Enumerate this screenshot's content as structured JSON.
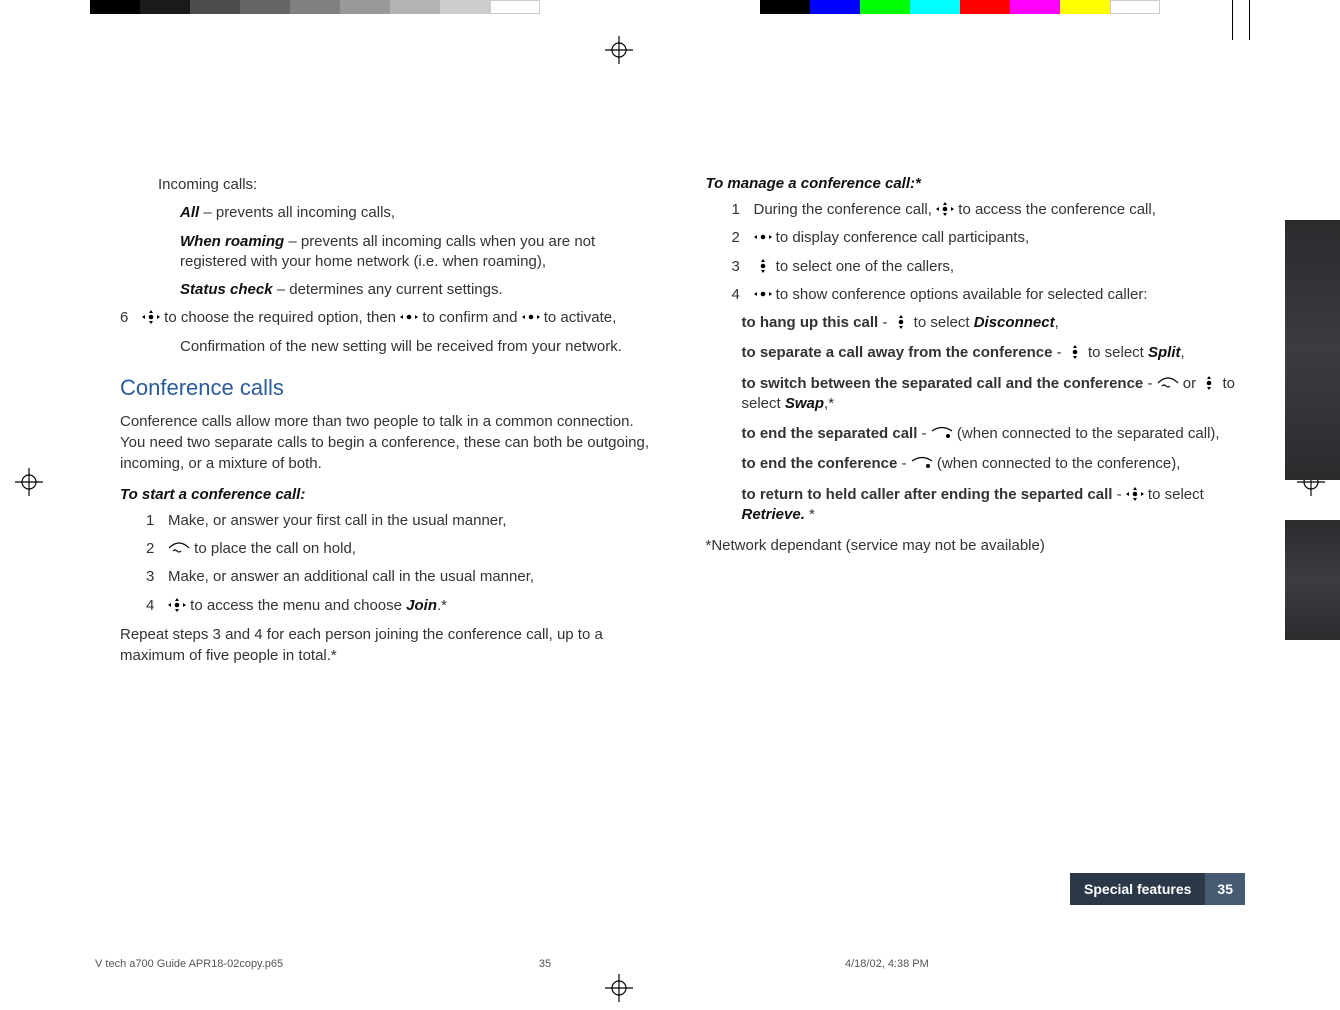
{
  "left": {
    "incoming_header": "Incoming calls:",
    "all_label": "All",
    "all_text": " – prevents all incoming calls,",
    "roam_label": "When roaming",
    "roam_text": " – prevents all incoming calls when you are not registered with your home network (i.e. when roaming),",
    "status_label": "Status check",
    "status_text": " – determines any current settings.",
    "step6_num": "6",
    "step6_a": " to choose the required option, then ",
    "step6_b": " to confirm and ",
    "step6_c": " to activate,",
    "confirm_text": "Confirmation of the new setting will be received from your network.",
    "h2": "Conference calls",
    "intro": "Conference calls allow more than two people to talk in a common connection. You need two separate calls to begin a conference, these can both be outgoing, incoming, or a mixture of both.",
    "start_head": "To start a conference call:",
    "s1_num": "1",
    "s1": "Make, or answer your first call in the usual manner,",
    "s2_num": "2",
    "s2": " to place the call on hold,",
    "s3_num": "3",
    "s3": "Make, or answer an additional call in the usual manner,",
    "s4_num": "4",
    "s4_a": " to access the menu and choose ",
    "s4_join": "Join",
    "s4_b": ".*",
    "repeat": "Repeat steps 3 and 4 for each person joining the conference call, up to a maximum of five people in total.*"
  },
  "right": {
    "manage_head": "To manage a conference call:*",
    "m1_num": "1",
    "m1_a": "During the conference call, ",
    "m1_b": " to access the conference call,",
    "m2_num": "2",
    "m2": "  to display conference call participants,",
    "m3_num": "3",
    "m3": " to select one of the callers,",
    "m4_num": "4",
    "m4": "  to show conference options available for selected caller:",
    "hang_label": "to hang up this call",
    "hang_a": " - ",
    "hang_b": " to select ",
    "hang_disc": " Disconnect",
    "hang_end": ",",
    "sep_label": "to separate a call away from the conference",
    "sep_a": " - ",
    "sep_b": " to select ",
    "sep_split": "Split",
    "sep_end": ",",
    "swap_label": "to switch between the separated call and the conference",
    "swap_a": " - ",
    "swap_b": " or ",
    "swap_c": " to select ",
    "swap_word": "Swap",
    "swap_end": ",*",
    "endsep_label": "to end the separated call",
    "endsep_a": " - ",
    "endsep_b": " (when connected to the separated call),",
    "endconf_label": "to end the conference",
    "endconf_a": " - ",
    "endconf_b": " (when connected to the conference),",
    "retr_label": "to return to held caller after ending the separted call",
    "retr_a": " - ",
    "retr_b": "  to select ",
    "retr_word": "Retrieve.",
    "retr_end": " *",
    "note": "*Network dependant (service may not be available)"
  },
  "footer": {
    "section": "Special features",
    "page": "35",
    "file": "V tech a700 Guide APR18-02copy.p65",
    "sheet": "35",
    "date": "4/18/02, 4:38 PM"
  }
}
